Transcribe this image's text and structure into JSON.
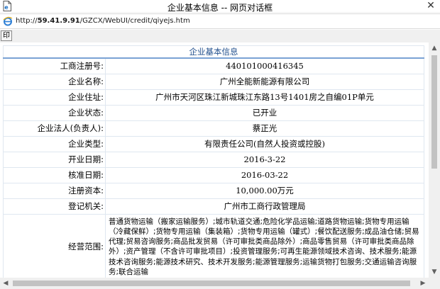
{
  "window": {
    "title": "企业基本信息 -- 网页对话框"
  },
  "address": {
    "scheme": "http://",
    "host": "59.41.9.91",
    "path": "/GZCX/WebUI/credit/qiyejs.htm"
  },
  "toolbar": {
    "print_label": "印"
  },
  "table": {
    "caption": "企业基本信息",
    "rows": [
      {
        "label": "工商注册号:",
        "value": "440101000416345"
      },
      {
        "label": "企业名称:",
        "value": "广州全能新能源有限公司"
      },
      {
        "label": "企业住址:",
        "value": "广州市天河区珠江新城珠江东路13号1401房之自编01P单元"
      },
      {
        "label": "企业状态:",
        "value": "已开业"
      },
      {
        "label": "企业法人(负责人):",
        "value": "蔡正光"
      },
      {
        "label": "企业类型:",
        "value": "有限责任公司(自然人投资或控股)"
      },
      {
        "label": "开业日期:",
        "value": "2016-3-22"
      },
      {
        "label": "核准日期:",
        "value": "2016-03-22"
      },
      {
        "label": "注册资本:",
        "value": "10,000.00万元"
      },
      {
        "label": "登记机关:",
        "value": "广州市工商行政管理局"
      },
      {
        "label": "经营范围:",
        "value": "普通货物运输（搬家运输服务）;城市轨道交通;危险化学品运输;道路货物运输;货物专用运输（冷藏保鲜）;货物专用运输（集装箱）;货物专用运输（罐式）;餐饮配送服务;成品油仓储;贸易代理;贸易咨询服务;商品批发贸易（许可审批类商品除外）;商品零售贸易（许可审批类商品除外）;资产管理（不含许可审批项目）;投资管理服务;可再生能源领域技术咨询、技术服务;能源技术咨询服务;能源技术研究、技术开发服务;能源管理服务;运输货物打包服务;交通运输咨询服务;联合运输"
      }
    ]
  },
  "colors": {
    "caption_text": "#1f4e8c",
    "caption_rule": "#7aa2d4",
    "cell_border": "#dfe7f0",
    "chrome_bg": "#f0f0f0",
    "scroll_thumb": "#c2c2c2"
  },
  "icons": {
    "window": "page-icon",
    "address": "ie-logo-icon",
    "close": "close-icon",
    "scroll_up": "arrow-up-icon",
    "scroll_down": "arrow-down-icon",
    "scroll_left": "arrow-left-icon",
    "scroll_right": "arrow-right-icon"
  }
}
